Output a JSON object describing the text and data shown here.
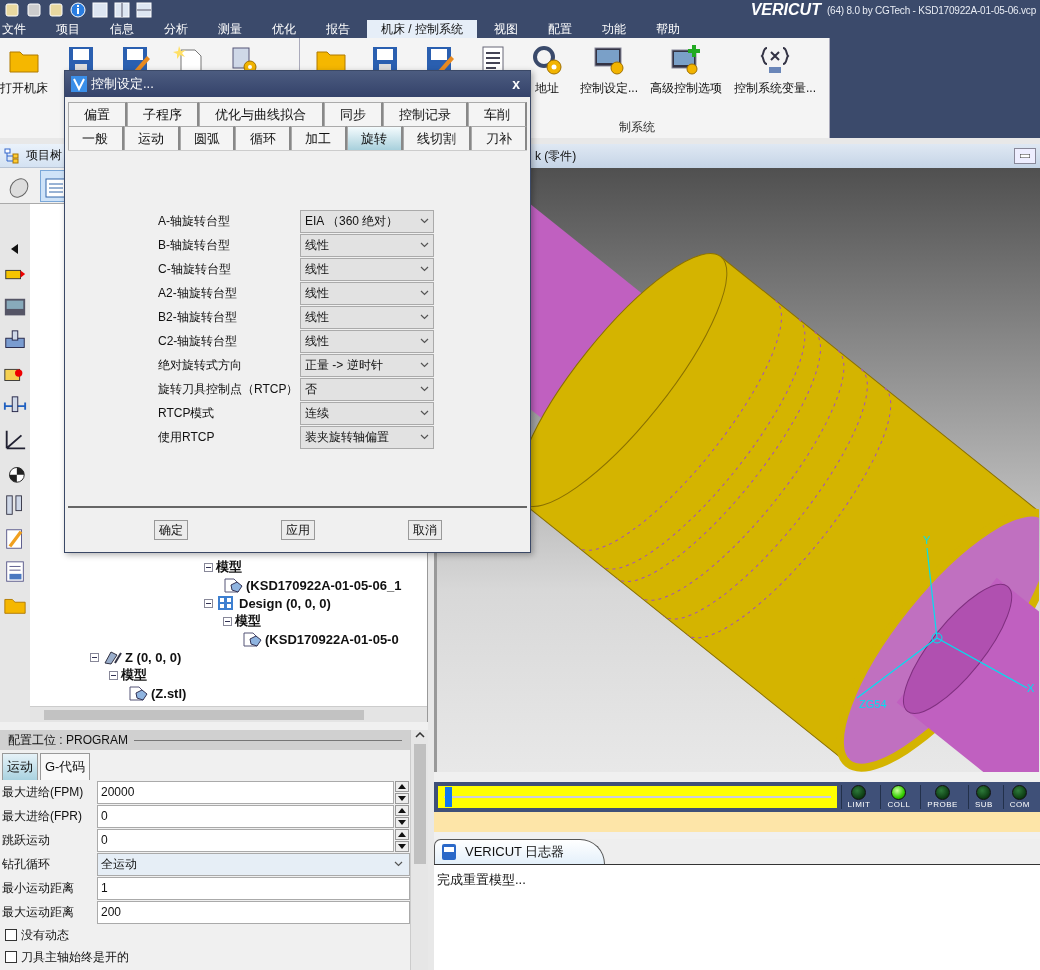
{
  "app": {
    "logo": "VERICUT",
    "title": "(64)  8.0 by CGTech - KSD170922A-01-05-06.vcp"
  },
  "menu": [
    {
      "label": "文件",
      "selected": false
    },
    {
      "label": "项目",
      "selected": false
    },
    {
      "label": "信息",
      "selected": false
    },
    {
      "label": "分析",
      "selected": false
    },
    {
      "label": "测量",
      "selected": false
    },
    {
      "label": "优化",
      "selected": false
    },
    {
      "label": "报告",
      "selected": false
    },
    {
      "label": "机床 / 控制系统",
      "selected": true
    },
    {
      "label": "视图",
      "selected": false
    },
    {
      "label": "配置",
      "selected": false
    },
    {
      "label": "功能",
      "selected": false
    },
    {
      "label": "帮助",
      "selected": false
    }
  ],
  "ribbon": {
    "groups": [
      {
        "items": [
          {
            "kind": "folder",
            "label": "打开机床"
          },
          {
            "kind": "save"
          },
          {
            "kind": "save-as"
          },
          {
            "kind": "new"
          },
          {
            "kind": "gear-doc"
          }
        ]
      },
      {
        "label": "制系统",
        "items": [
          {
            "kind": "folder"
          },
          {
            "kind": "save"
          },
          {
            "kind": "save-as"
          },
          {
            "kind": "list"
          },
          {
            "kind": "g-gear",
            "label": "地址"
          },
          {
            "kind": "screen-gear",
            "label": "控制设定..."
          },
          {
            "kind": "screen-plus",
            "label": "高级控制选项"
          },
          {
            "kind": "variable",
            "label": "控制系统变量..."
          }
        ]
      }
    ]
  },
  "project_tree": {
    "title": "项目树",
    "nodes": [
      {
        "children": [
          {
            "children": [
              {
                "children": [
                  {
                    "children": [
                      {
                        "children": [
                          {
                            "children": [
                              {
                                "label": "模型",
                                "children": [
                                  {
                                    "kind": "file",
                                    "label": "(KSD170922A-01-05-06_1"
                                  }
                                ]
                              },
                              {
                                "kind": "design",
                                "label": "Design (0, 0, 0)",
                                "children": [
                                  {
                                    "label": "模型",
                                    "children": [
                                      {
                                        "kind": "file",
                                        "label": "(KSD170922A-01-05-0"
                                      }
                                    ]
                                  }
                                ]
                              }
                            ]
                          }
                        ]
                      }
                    ]
                  }
                ]
              }
            ]
          }
        ]
      },
      {
        "kind": "axis",
        "label": "Z (0, 0, 0)",
        "children": [
          {
            "label": "模型",
            "children": [
              {
                "kind": "file",
                "label": "(Z.stl)"
              }
            ]
          }
        ]
      }
    ]
  },
  "config": {
    "title": "配置工位 : PROGRAM",
    "tabs": [
      {
        "label": "运动",
        "selected": true
      },
      {
        "label": "G-代码",
        "selected": false
      }
    ],
    "fields": [
      {
        "kind": "spinner",
        "label": "最大进给(FPM)",
        "value": "20000"
      },
      {
        "kind": "spinner",
        "label": "最大进给(FPR)",
        "value": "0"
      },
      {
        "kind": "spinner",
        "label": "跳跃运动",
        "value": "0"
      },
      {
        "kind": "select",
        "label": "钻孔循环",
        "value": "全运动"
      },
      {
        "kind": "text",
        "label": "最小运动距离",
        "value": "1"
      },
      {
        "kind": "text",
        "label": "最大运动距离",
        "value": "200"
      }
    ],
    "checkboxes": [
      {
        "label": "没有动态",
        "checked": false
      },
      {
        "label": "刀具主轴始终是开的",
        "checked": false
      }
    ]
  },
  "view": {
    "title": "k (零件)",
    "axis_labels": [
      "Y",
      "X",
      "ZG54"
    ]
  },
  "playback": {
    "level": 0.01,
    "lights": [
      {
        "label": "LIMIT",
        "on": false
      },
      {
        "label": "COLL",
        "on": true
      },
      {
        "label": "PROBE",
        "on": false
      },
      {
        "label": "SUB",
        "on": false
      },
      {
        "label": "COM",
        "on": false
      }
    ]
  },
  "log": {
    "tab": "VERICUT 日志器",
    "lines": [
      "完成重置模型..."
    ]
  },
  "dialog": {
    "title": "控制设定...",
    "close": "x",
    "tab_rows": [
      [
        {
          "label": "偏置",
          "selected": false
        },
        {
          "label": "子程序",
          "selected": false
        },
        {
          "label": "优化与曲线拟合",
          "selected": false
        },
        {
          "label": "同步",
          "selected": false
        },
        {
          "label": "控制记录",
          "selected": false
        },
        {
          "label": "车削",
          "selected": false
        }
      ],
      [
        {
          "label": "一般",
          "selected": false
        },
        {
          "label": "运动",
          "selected": false
        },
        {
          "label": "圆弧",
          "selected": false
        },
        {
          "label": "循环",
          "selected": false
        },
        {
          "label": "加工",
          "selected": false
        },
        {
          "label": "旋转",
          "selected": true
        },
        {
          "label": "线切割",
          "selected": false
        },
        {
          "label": "刀补",
          "selected": false
        }
      ]
    ],
    "fields": [
      {
        "label": "A-轴旋转台型",
        "value": "EIA （360 绝对）"
      },
      {
        "label": "B-轴旋转台型",
        "value": "线性"
      },
      {
        "label": "C-轴旋转台型",
        "value": "线性"
      },
      {
        "label": "A2-轴旋转台型",
        "value": "线性"
      },
      {
        "label": "B2-轴旋转台型",
        "value": "线性"
      },
      {
        "label": "C2-轴旋转台型",
        "value": "线性"
      },
      {
        "label": "绝对旋转式方向",
        "value": "正量 -> 逆时针"
      },
      {
        "label": "旋转刀具控制点（RTCP）",
        "value": "否"
      },
      {
        "label": "RTCP模式",
        "value": "连续"
      },
      {
        "label": "使用RTCP",
        "value": "装夹旋转轴偏置"
      }
    ],
    "buttons": [
      "确定",
      "应用",
      "取消"
    ]
  }
}
